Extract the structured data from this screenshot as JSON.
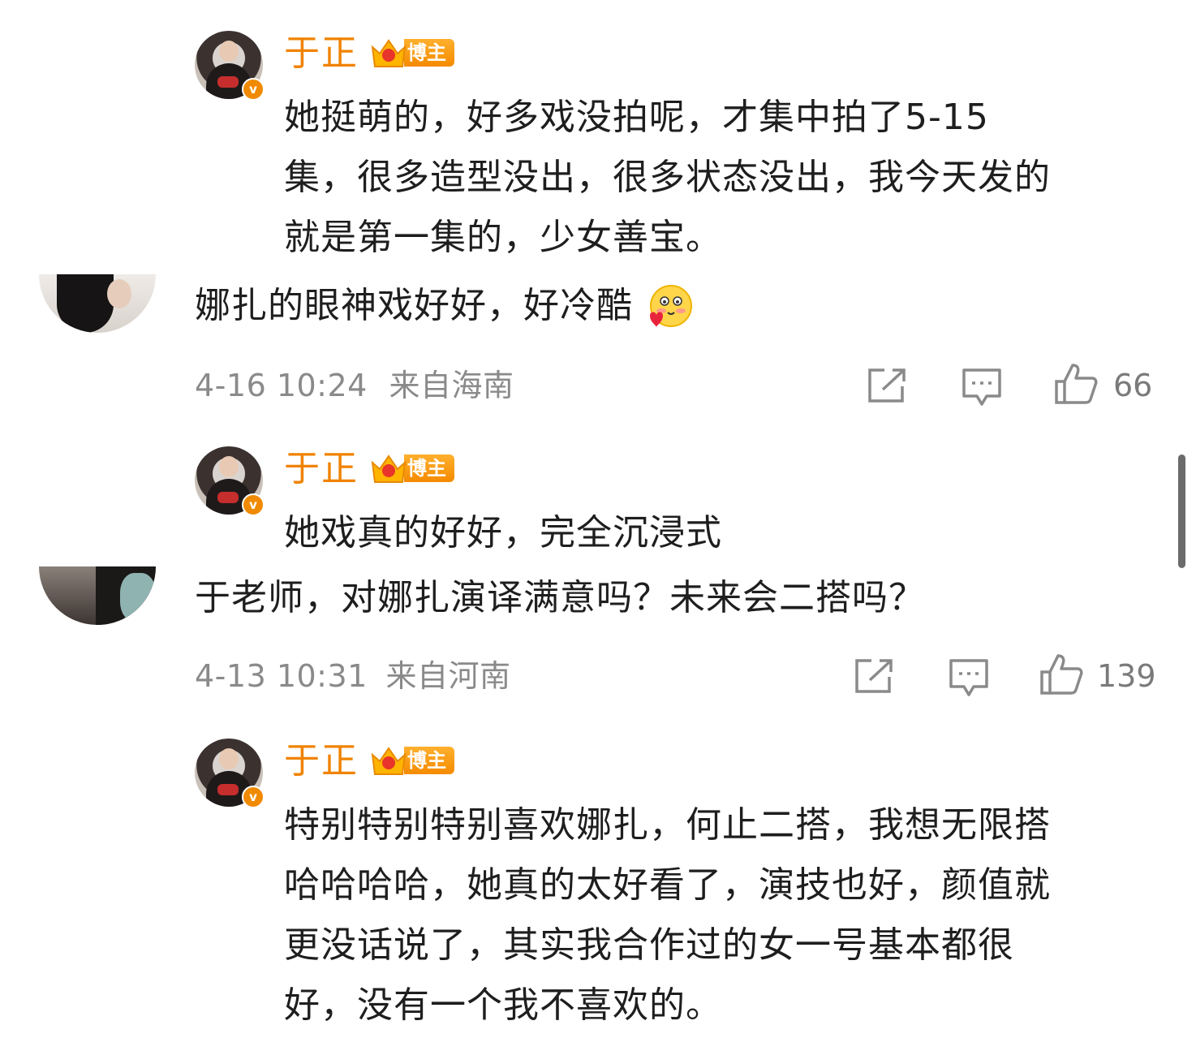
{
  "threads": [
    {
      "reply": {
        "author": "于正",
        "badge": "博主",
        "verified_mark": "v",
        "lines": [
          "她挺萌的，好多戏没拍呢，才集中拍了5-15",
          "集，很多造型没出，很多状态没出，我今天发的",
          "就是第一集的，少女善宝。"
        ]
      }
    },
    {
      "comment": {
        "text": "娜扎的眼神戏好好，好冷酷",
        "emoji": "blushing-heart-emoji",
        "date": "4-16 10:24",
        "location": "来自海南",
        "likes": "66"
      }
    },
    {
      "reply": {
        "author": "于正",
        "badge": "博主",
        "verified_mark": "v",
        "lines": [
          "她戏真的好好，完全沉浸式"
        ]
      }
    },
    {
      "comment": {
        "text": "于老师，对娜扎演译满意吗？未来会二搭吗？",
        "date": "4-13 10:31",
        "location": "来自河南",
        "likes": "139"
      }
    },
    {
      "reply": {
        "author": "于正",
        "badge": "博主",
        "verified_mark": "v",
        "lines": [
          "特别特别特别喜欢娜扎，何止二搭，我想无限搭",
          "哈哈哈哈，她真的太好看了，演技也好，颜值就",
          "更没话说了，其实我合作过的女一号基本都很",
          "好，没有一个我不喜欢的。"
        ]
      }
    }
  ],
  "icons": {
    "share": "share-icon",
    "comment": "comment-icon",
    "like": "thumbs-up-icon",
    "crown": "crown-icon"
  },
  "colors": {
    "name": "#f08300",
    "badge": "#f58a00",
    "text": "#1e1e1e",
    "meta": "#8a8a8a"
  }
}
